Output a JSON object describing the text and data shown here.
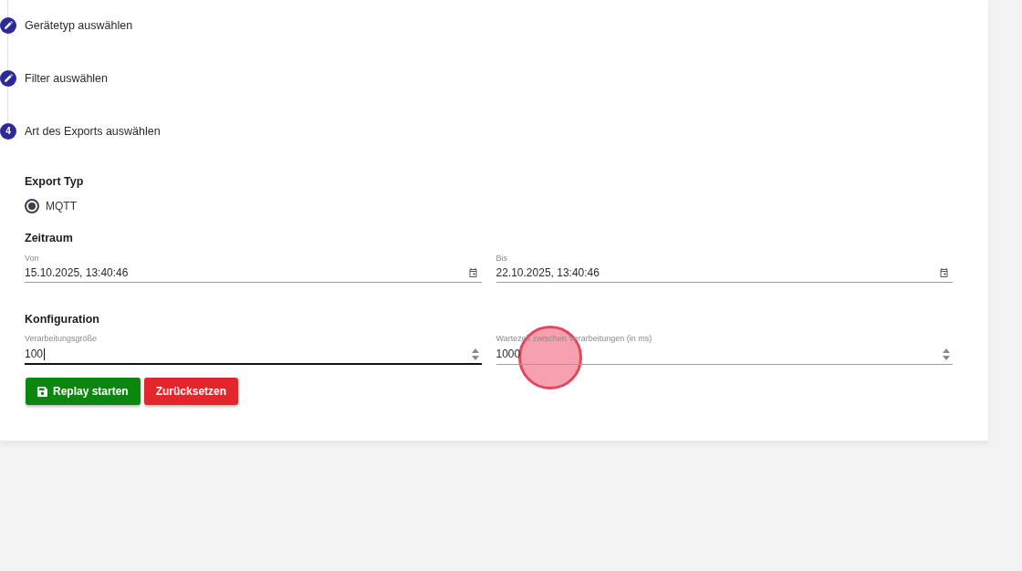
{
  "stepper": {
    "steps": [
      {
        "label": "Gerätetyp auswählen",
        "kind": "edit"
      },
      {
        "label": "Filter auswählen",
        "kind": "edit"
      },
      {
        "label": "Art des Exports auswählen",
        "kind": "current",
        "number": "4"
      }
    ]
  },
  "export_type": {
    "heading": "Export Typ",
    "options": [
      {
        "label": "MQTT",
        "selected": true
      }
    ]
  },
  "time_range": {
    "heading": "Zeitraum",
    "fields": [
      {
        "label": "Von",
        "value": "15.10.2025, 13:40:46"
      },
      {
        "label": "Bis",
        "value": "22.10.2025, 13:40:46"
      }
    ]
  },
  "configuration": {
    "heading": "Konfiguration",
    "fields": [
      {
        "label": "Verarbeitungsgröße",
        "value": "100",
        "focused": true
      },
      {
        "label": "Wartezeit zwischen Verarbeitungen (in ms)",
        "value": "1000",
        "focused": false
      }
    ]
  },
  "buttons": [
    {
      "label": "Replay starten",
      "kind": "save"
    },
    {
      "label": "Zurücksetzen",
      "kind": "reset"
    }
  ]
}
